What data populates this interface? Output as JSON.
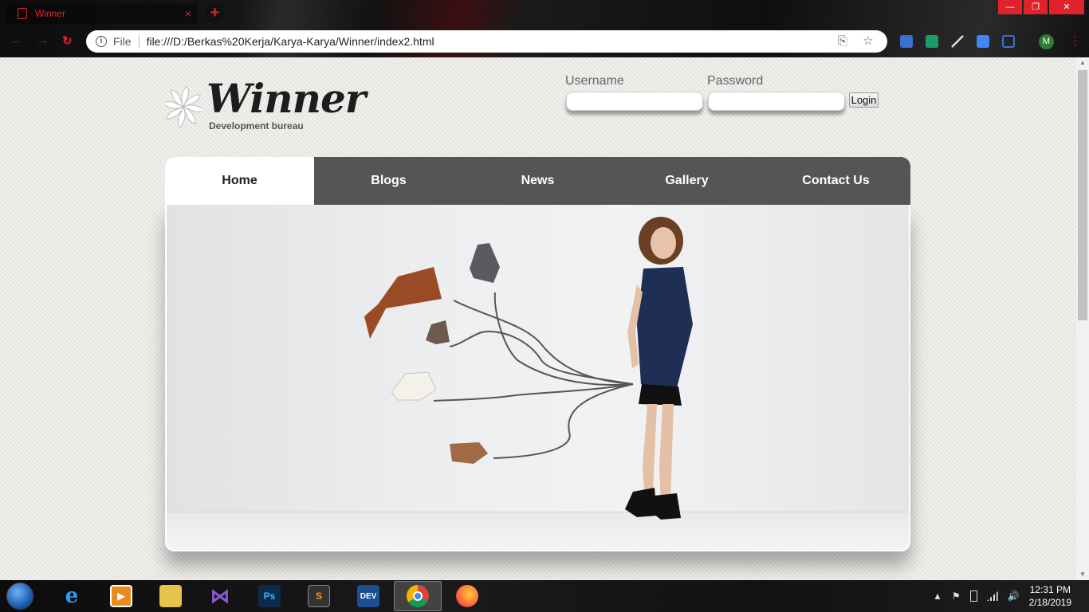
{
  "browser": {
    "tab_title": "Winner",
    "tab_close": "×",
    "new_tab": "+",
    "win_min": "—",
    "win_restore": "❐",
    "win_close": "✕",
    "back": "←",
    "forward": "→",
    "reload": "↻",
    "info": "i",
    "file_label": "File",
    "url": "file:///D:/Berkas%20Kerja/Karya-Karya/Winner/index2.html",
    "translate": "⎘",
    "star": "☆",
    "profile_initial": "M",
    "menu": "⋮",
    "accent": "#e0232b"
  },
  "logo": {
    "name": "Winner",
    "tagline": "Development bureau"
  },
  "login": {
    "username_label": "Username",
    "password_label": "Password",
    "username_value": "",
    "password_value": "",
    "button": "Login"
  },
  "menu": {
    "items": [
      "Home",
      "Blogs",
      "News",
      "Gallery",
      "Contact Us"
    ],
    "active": "Home"
  },
  "scroll": {
    "up": "▲",
    "down": "▼"
  },
  "taskbar": {
    "apps": [
      "internet-explorer",
      "media-player",
      "file-explorer",
      "visual-studio",
      "photoshop",
      "sublime-text",
      "devexpress",
      "chrome",
      "firefox"
    ],
    "ps_label": "Ps",
    "sublime_label": "S",
    "dev_label": "DEV",
    "tray_up": "▲",
    "tray_flag": "⚑",
    "tray_volume": "🔊",
    "time": "12:31 PM",
    "date": "2/18/2019"
  }
}
